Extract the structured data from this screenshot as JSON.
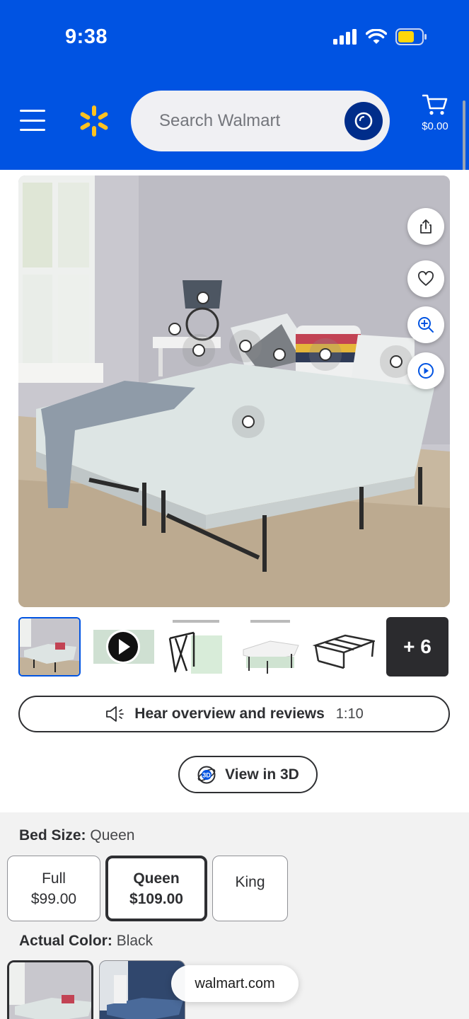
{
  "status_bar": {
    "time": "9:38"
  },
  "header": {
    "search": {
      "placeholder": "Search Walmart"
    },
    "cart": {
      "amount": "$0.00"
    }
  },
  "hero_actions": [
    "share-icon",
    "heart-icon",
    "zoom-icon",
    "play-circle-icon"
  ],
  "thumbnails": {
    "more_label": "+ 6"
  },
  "hear_overview": {
    "label": "Hear overview and reviews",
    "duration": "1:10"
  },
  "view_3d": {
    "label": "View in 3D",
    "icon_text": "3D"
  },
  "bed_size": {
    "label": "Bed Size:",
    "value": "Queen",
    "options": [
      {
        "name": "Full",
        "price": "$99.00"
      },
      {
        "name": "Queen",
        "price": "$109.00"
      },
      {
        "name": "King",
        "price": ""
      }
    ]
  },
  "actual_color": {
    "label": "Actual Color:",
    "value": "Black"
  },
  "browser": {
    "domain": "walmart.com"
  },
  "colors": {
    "brand_blue": "#0053e2",
    "dark_blue": "#002d8a",
    "spark_yellow": "#ffc220"
  }
}
